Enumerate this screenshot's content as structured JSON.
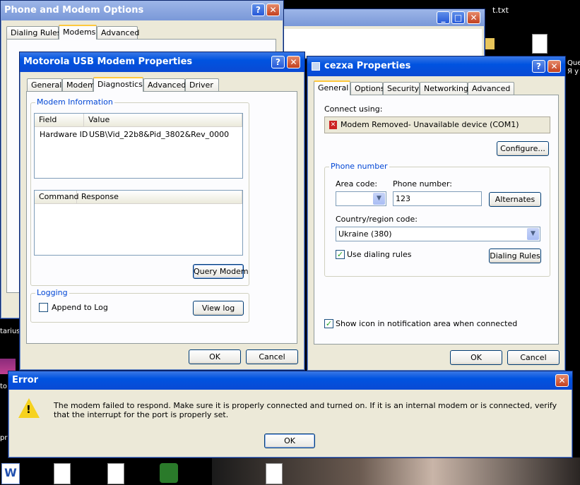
{
  "desktop": {
    "bg_text_file": "t.txt",
    "bg_text_right1": "Que",
    "bg_text_right2": "Я у",
    "bg_text_left1": "tarius",
    "bg_text_left2": "to",
    "bg_text_left3": "pru"
  },
  "phone_modem": {
    "title": "Phone and Modem Options",
    "tabs": [
      "Dialing Rules",
      "Modems",
      "Advanced"
    ]
  },
  "motorola": {
    "title": "Motorola USB Modem Properties",
    "tabs": [
      "General",
      "Modem",
      "Diagnostics",
      "Advanced",
      "Driver"
    ],
    "modem_info_label": "Modem Information",
    "info_headers": [
      "Field",
      "Value"
    ],
    "info_rows": [
      [
        "Hardware ID",
        "USB\\Vid_22b8&Pid_3802&Rev_0000"
      ]
    ],
    "cmd_headers": [
      "Command",
      "Response"
    ],
    "query_button": "Query Modem",
    "logging_label": "Logging",
    "append_log": "Append to Log",
    "view_log": "View log",
    "ok": "OK",
    "cancel": "Cancel"
  },
  "cezxa": {
    "title": "cezxa Properties",
    "tabs": [
      "General",
      "Options",
      "Security",
      "Networking",
      "Advanced"
    ],
    "connect_using": "Connect using:",
    "device": "Modem Removed- Unavailable device (COM1)",
    "configure": "Configure...",
    "phone_group": "Phone number",
    "area_code_label": "Area code:",
    "area_code_value": "",
    "phone_label": "Phone number:",
    "phone_value": "123",
    "alternates": "Alternates",
    "country_label": "Country/region code:",
    "country_value": "Ukraine (380)",
    "use_dialing_rules": "Use dialing rules",
    "dialing_rules_btn": "Dialing Rules",
    "show_icon": "Show icon in notification area when connected",
    "ok": "OK",
    "cancel": "Cancel"
  },
  "error": {
    "title": "Error",
    "message": "The modem failed to respond. Make sure it is properly connected and turned on.  If it is an internal modem or is connected, verify that the interrupt for the port is properly set.",
    "ok": "OK"
  }
}
